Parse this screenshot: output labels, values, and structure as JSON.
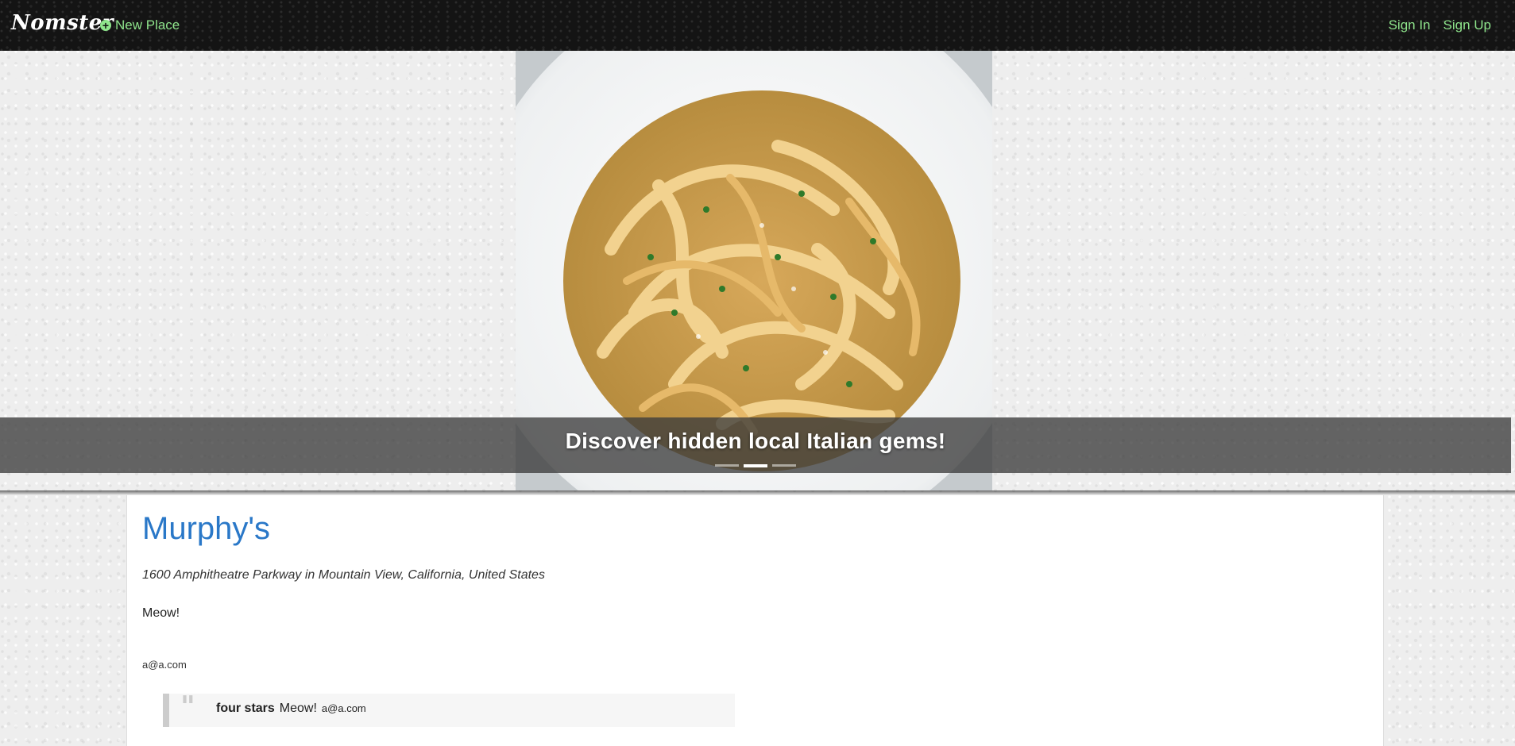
{
  "navbar": {
    "brand": "Nomster",
    "new_place_label": "New Place",
    "sign_in_label": "Sign In",
    "sign_up_label": "Sign Up",
    "accent_color": "#8fe58c"
  },
  "hero": {
    "caption": "Discover hidden local Italian gems!",
    "image_subject": "plate of fettuccine pasta with parmesan and herbs",
    "slides_total": 3,
    "active_slide": 2
  },
  "place": {
    "name": "Murphy's",
    "address": "1600 Amphitheatre Parkway in Mountain View, California, United States",
    "description": "Meow!",
    "author": "a@a.com",
    "name_color": "#2a78c8"
  },
  "comments": [
    {
      "rating": "four stars",
      "message": "Meow!",
      "author": "a@a.com"
    }
  ]
}
